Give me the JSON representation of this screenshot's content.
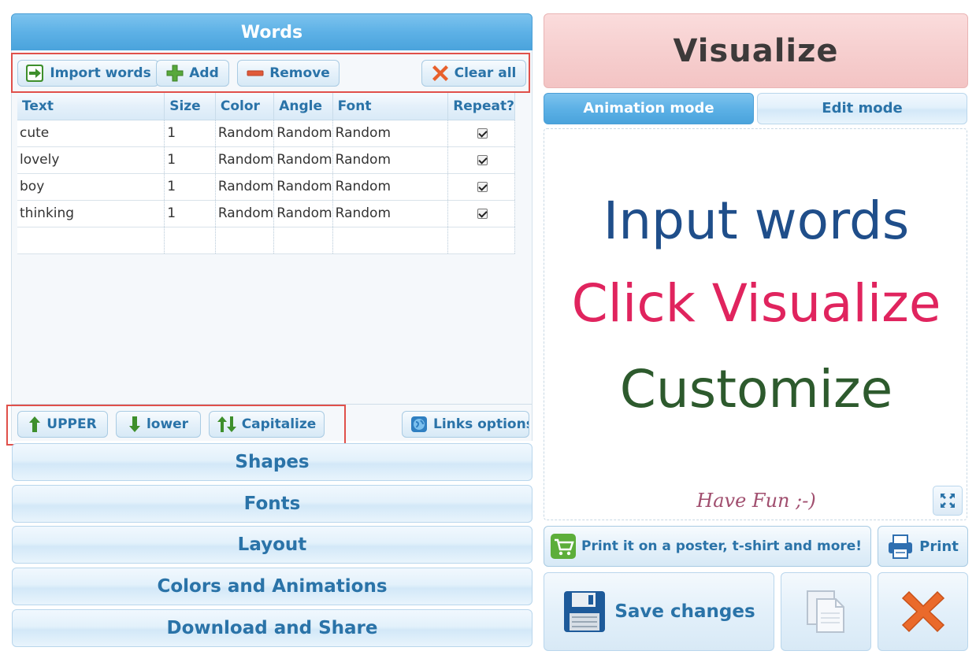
{
  "words": {
    "title": "Words",
    "toolbar": {
      "import_label": "Import words",
      "add_label": "Add",
      "remove_label": "Remove",
      "clear_label": "Clear all"
    },
    "table": {
      "columns": [
        "Text",
        "Size",
        "Color",
        "Angle",
        "Font",
        "Repeat?"
      ],
      "rows": [
        {
          "text": "cute",
          "size": "1",
          "color": "Random",
          "angle": "Random",
          "font": "Random",
          "repeat": true
        },
        {
          "text": "lovely",
          "size": "1",
          "color": "Random",
          "angle": "Random",
          "font": "Random",
          "repeat": true
        },
        {
          "text": "boy",
          "size": "1",
          "color": "Random",
          "angle": "Random",
          "font": "Random",
          "repeat": true
        },
        {
          "text": "thinking",
          "size": "1",
          "color": "Random",
          "angle": "Random",
          "font": "Random",
          "repeat": true
        }
      ]
    },
    "case_buttons": {
      "upper_label": "UPPER",
      "lower_label": "lower",
      "capitalize_label": "Capitalize",
      "links_label": "Links options"
    }
  },
  "accordion": {
    "shapes": "Shapes",
    "fonts": "Fonts",
    "layout": "Layout",
    "colors": "Colors and Animations",
    "download": "Download and Share"
  },
  "visualize": {
    "label": "Visualize",
    "modes": {
      "animation": "Animation mode",
      "edit": "Edit mode"
    }
  },
  "canvas": {
    "line1": "Input words",
    "line2": "Click Visualize",
    "line3": "Customize",
    "footer": "Have Fun ;-)",
    "colors": {
      "line1": "#1f4e8a",
      "line2": "#e0245e",
      "line3": "#2d5a2d",
      "footer": "#a14f6f"
    }
  },
  "actions": {
    "poster_label": "Print it on a poster, t-shirt and more!",
    "print_label": "Print",
    "save_label": "Save changes"
  },
  "colors": {
    "accent_blue": "#4aa3dc",
    "visualize_pink": "#f6cfcf",
    "highlight_red": "#e0504a"
  }
}
